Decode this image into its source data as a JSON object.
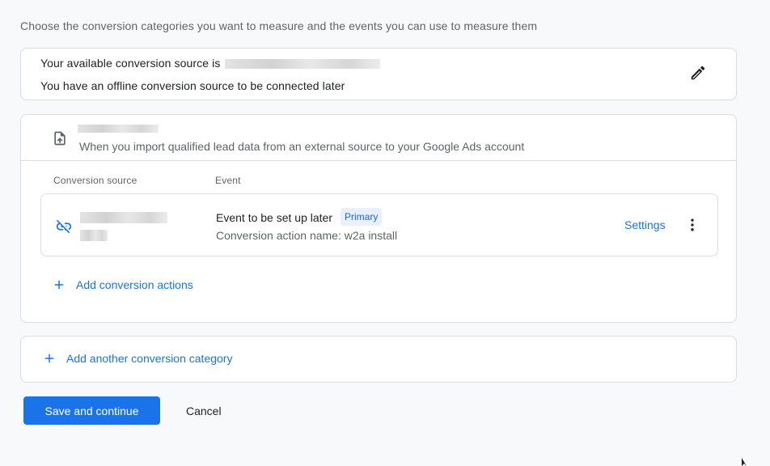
{
  "intro_text": "Choose the conversion categories you want to measure and the events you can use to measure them",
  "source_card": {
    "line1_prefix": "Your available conversion source is",
    "line2": "You have an offline conversion source to be connected later",
    "edit_icon": "pencil-icon"
  },
  "category_card": {
    "icon": "upload-file-icon",
    "description": "When you import qualified lead data from an external source to your Google Ads account",
    "columns": {
      "source": "Conversion source",
      "event": "Event"
    },
    "rows": [
      {
        "source_icon": "link-off-icon",
        "event_title": "Event to be set up later",
        "badge": "Primary",
        "action_name": "Conversion action name: w2a install",
        "settings_label": "Settings",
        "menu_icon": "more-vert-icon"
      }
    ],
    "add_actions_label": "Add conversion actions"
  },
  "add_category_label": "Add another conversion category",
  "buttons": {
    "save": "Save and continue",
    "cancel": "Cancel"
  },
  "colors": {
    "accent": "#1a73e8",
    "badge_bg": "#e8f0fe",
    "border": "#dadce0"
  }
}
